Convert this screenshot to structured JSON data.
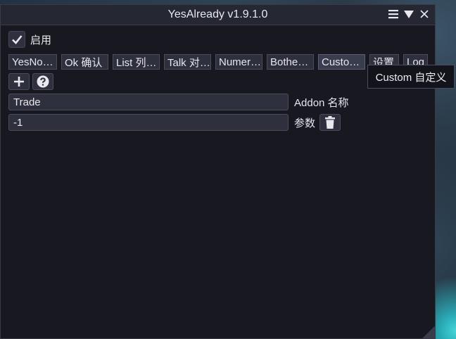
{
  "window": {
    "title": "YesAlready v1.9.1.0",
    "icons": [
      "menu-icon",
      "collapse-icon",
      "close-icon"
    ]
  },
  "enable": {
    "label": "启用",
    "checked": true
  },
  "tabs": [
    {
      "label": "YesNo…",
      "active": false
    },
    {
      "label": "Ok 确认",
      "active": false
    },
    {
      "label": "List 列…",
      "active": false
    },
    {
      "label": "Talk 对…",
      "active": false
    },
    {
      "label": "Numer…",
      "active": false
    },
    {
      "label": "Bothe…",
      "active": false
    },
    {
      "label": "Custo…",
      "active": true
    },
    {
      "label": "设置",
      "active": false
    },
    {
      "label": "Log",
      "active": false
    }
  ],
  "toolbar": {
    "add_icon": "plus-icon",
    "help_icon": "question-icon"
  },
  "form": {
    "addon_value": "Trade",
    "addon_label": "Addon 名称",
    "param_value": "-1",
    "param_label": "参数",
    "delete_icon": "trash-icon"
  },
  "tooltip": {
    "text": "Custom 自定义"
  }
}
